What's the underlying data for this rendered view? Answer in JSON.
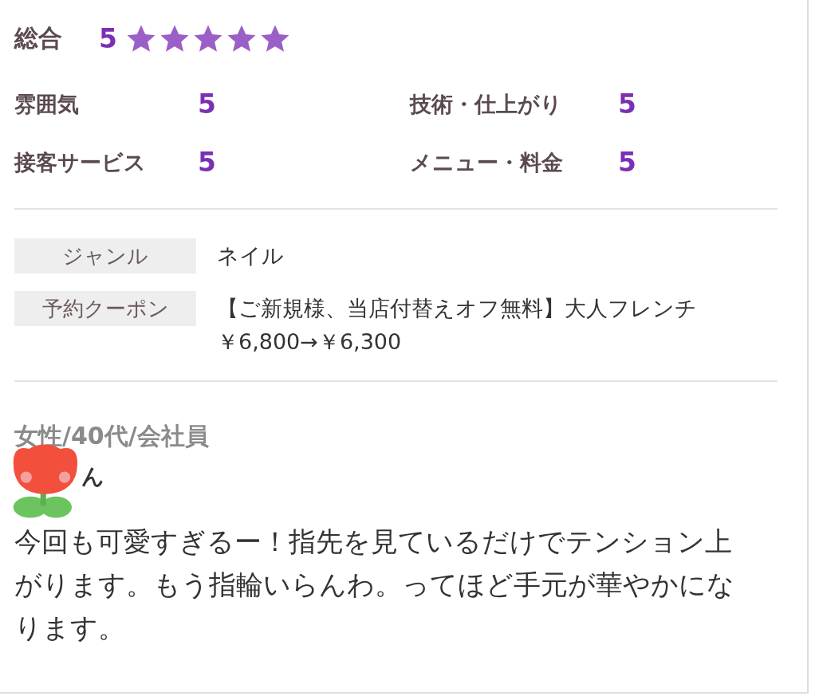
{
  "overall": {
    "label": "総合",
    "score": "5",
    "stars": 5
  },
  "categories": [
    {
      "label": "雰囲気",
      "score": "5"
    },
    {
      "label": "技術・仕上がり",
      "score": "5"
    },
    {
      "label": "接客サービス",
      "score": "5"
    },
    {
      "label": "メニュー・料金",
      "score": "5"
    }
  ],
  "details": [
    {
      "label": "ジャンル",
      "lines": [
        "ネイル"
      ]
    },
    {
      "label": "予約クーポン",
      "lines": [
        "【ご新規様、当店付替えオフ無料】大人フレンチ",
        "￥6,800→￥6,300"
      ]
    }
  ],
  "reviewer": {
    "profile": "女性/40代/会社員",
    "name": "ん"
  },
  "review": "今回も可愛すぎるー！指先を見ているだけでテンション上がります。もう指輪いらんわ。ってほど手元が華やかになります。"
}
